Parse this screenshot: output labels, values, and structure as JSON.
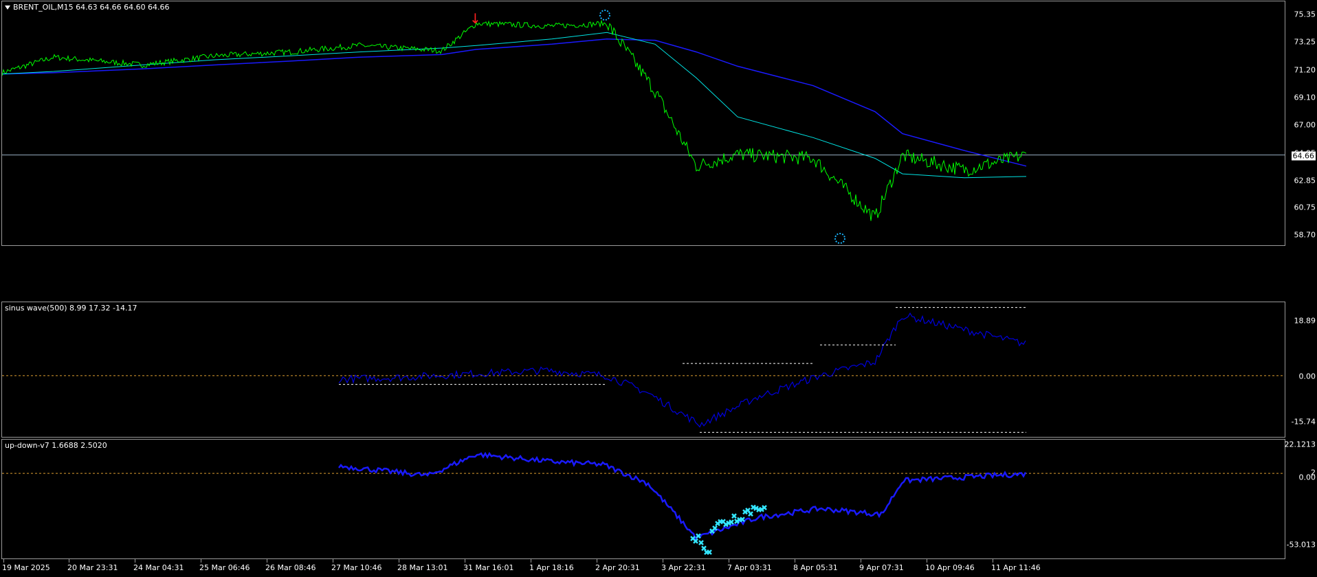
{
  "main_panel": {
    "label": "BRENT_OIL,M15  64.63 64.66 64.60 64.66",
    "current_price": "64.66",
    "y_ticks": [
      "75.35",
      "73.25",
      "71.20",
      "69.10",
      "67.00",
      "64.95",
      "62.85",
      "60.75",
      "58.70"
    ]
  },
  "sinus_panel": {
    "label": "sinus wave(500) 8.99 17.32 -14.17",
    "y_ticks": [
      "18.89",
      "0.00",
      "-15.74"
    ]
  },
  "updown_panel": {
    "label": "up-down-v7 1.6688 2.5020",
    "y_ticks": [
      "22.1213",
      "2",
      "0.00",
      "-53.013"
    ]
  },
  "x_ticks": [
    "19 Mar 2025",
    "20 Mar 23:31",
    "24 Mar 04:31",
    "25 Mar 06:46",
    "26 Mar 08:46",
    "27 Mar 10:46",
    "28 Mar 13:01",
    "31 Mar 16:01",
    "1 Apr 18:16",
    "2 Apr 20:31",
    "3 Apr 22:31",
    "7 Apr 03:31",
    "8 Apr 05:31",
    "9 Apr 07:31",
    "10 Apr 09:46",
    "11 Apr 11:46"
  ],
  "colors": {
    "price": "#00ff00",
    "ma_fast": "#00e5e5",
    "ma_slow": "#1a1aff",
    "indicator": "#0000dd",
    "level": "#e0a030",
    "markers": "#19b6ff"
  },
  "chart_data": [
    {
      "type": "line",
      "title": "BRENT_OIL,M15",
      "x": [
        "19 Mar",
        "20 Mar",
        "24 Mar",
        "25 Mar",
        "26 Mar",
        "27 Mar",
        "28 Mar",
        "31 Mar",
        "1 Apr",
        "2 Apr",
        "3 Apr",
        "4 Apr",
        "7 Apr",
        "8 Apr",
        "9 Apr",
        "10 Apr",
        "11 Apr"
      ],
      "series": [
        {
          "values": [
            71.0,
            72.2,
            71.6,
            72.3,
            72.6,
            73.1,
            72.7,
            74.8,
            74.6,
            74.8,
            69.6,
            63.8,
            64.7,
            64.4,
            59.8,
            64.6,
            63.5,
            64.66
          ]
        },
        {
          "values": [
            70.9,
            71.1,
            71.6,
            72.0,
            72.3,
            72.6,
            72.9,
            73.1,
            73.6,
            74.1,
            73.2,
            70.6,
            67.6,
            66.0,
            64.4,
            63.2,
            62.9,
            63.0
          ]
        },
        {
          "values": [
            70.9,
            71.0,
            71.3,
            71.6,
            71.9,
            72.2,
            72.4,
            72.8,
            73.2,
            73.6,
            73.5,
            72.6,
            71.5,
            70.0,
            68.0,
            66.3,
            65.0,
            63.8
          ]
        }
      ],
      "ylim": [
        57.7,
        76.5
      ]
    },
    {
      "type": "line",
      "title": "sinus wave(500)",
      "x": [
        "27 Mar",
        "28 Mar",
        "31 Mar",
        "1 Apr",
        "2 Apr",
        "3 Apr",
        "4 Apr",
        "7 Apr",
        "8 Apr",
        "9 Apr",
        "10 Apr",
        "11 Apr"
      ],
      "values": [
        -1.0,
        -0.5,
        0.5,
        1.5,
        0.0,
        -5.0,
        -14.0,
        -6.0,
        0.0,
        4.0,
        17.3,
        9.0
      ],
      "ylim": [
        -17.5,
        21.0
      ]
    },
    {
      "type": "line",
      "title": "up-down-v7",
      "x": [
        "27 Mar",
        "28 Mar",
        "31 Mar",
        "1 Apr",
        "2 Apr",
        "3 Apr",
        "4 Apr",
        "7 Apr",
        "8 Apr",
        "9 Apr",
        "10 Apr",
        "11 Apr"
      ],
      "values": [
        7.0,
        0.5,
        15.0,
        10.0,
        8.0,
        -5.0,
        -42.0,
        -28.0,
        -22.0,
        -26.0,
        -3.0,
        1.7
      ],
      "ylim": [
        -56.0,
        25.0
      ]
    }
  ]
}
